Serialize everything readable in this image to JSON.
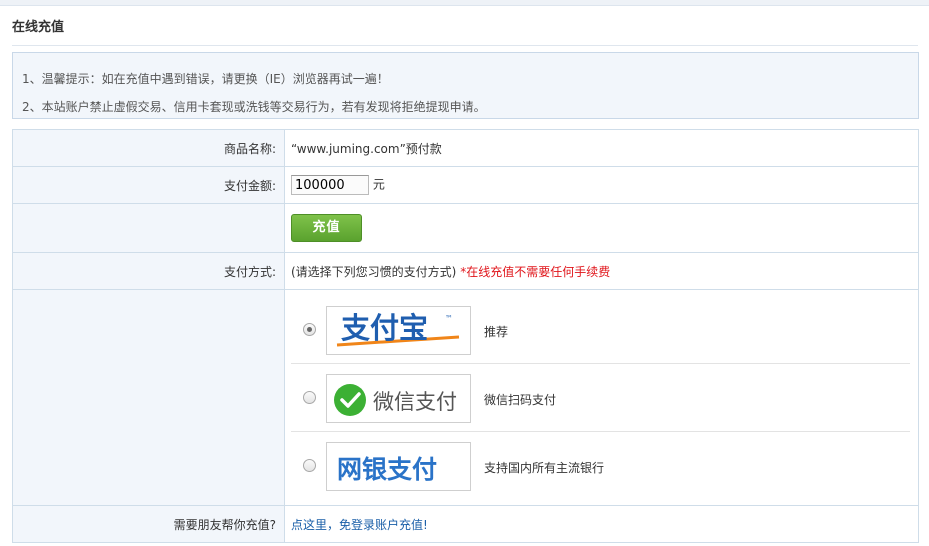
{
  "panel": {
    "title": "在线充值"
  },
  "tips": [
    "1、温馨提示：如在充值中遇到错误，请更换（IE）浏览器再试一遍！",
    "2、本站账户禁止虚假交易、信用卡套现或洗钱等交易行为，若有发现将拒绝提现申请。"
  ],
  "form": {
    "product_label": "商品名称:",
    "product_value": "“www.juming.com”预付款",
    "amount_label": "支付金额:",
    "amount_value": "100000",
    "amount_unit": "元",
    "recharge_button": "充值",
    "method_label": "支付方式:",
    "method_hint": "(请选择下列您习惯的支付方式)",
    "method_note": "*在线充值不需要任何手续费",
    "friend_label": "需要朋友帮你充值?",
    "friend_link": "点这里，免登录账户充值!"
  },
  "payment_options": [
    {
      "logo_text": "支付宝",
      "logo_mark": "™",
      "description": "推荐",
      "selected": true,
      "icon": "alipay-logo"
    },
    {
      "logo_text": "微信支付",
      "description": "微信扫码支付",
      "selected": false,
      "icon": "wechat-pay-logo"
    },
    {
      "logo_text": "网银支付",
      "description": "支持国内所有主流银行",
      "selected": false,
      "icon": "online-banking-logo"
    }
  ],
  "colors": {
    "accent_green": "#5aa22e",
    "note_red": "#e0141a",
    "link_blue": "#1a5fa8",
    "alipay_blue": "#1f5eaf",
    "alipay_orange": "#f08519",
    "wechat_green": "#3cb034",
    "bank_blue": "#2a73c8"
  }
}
